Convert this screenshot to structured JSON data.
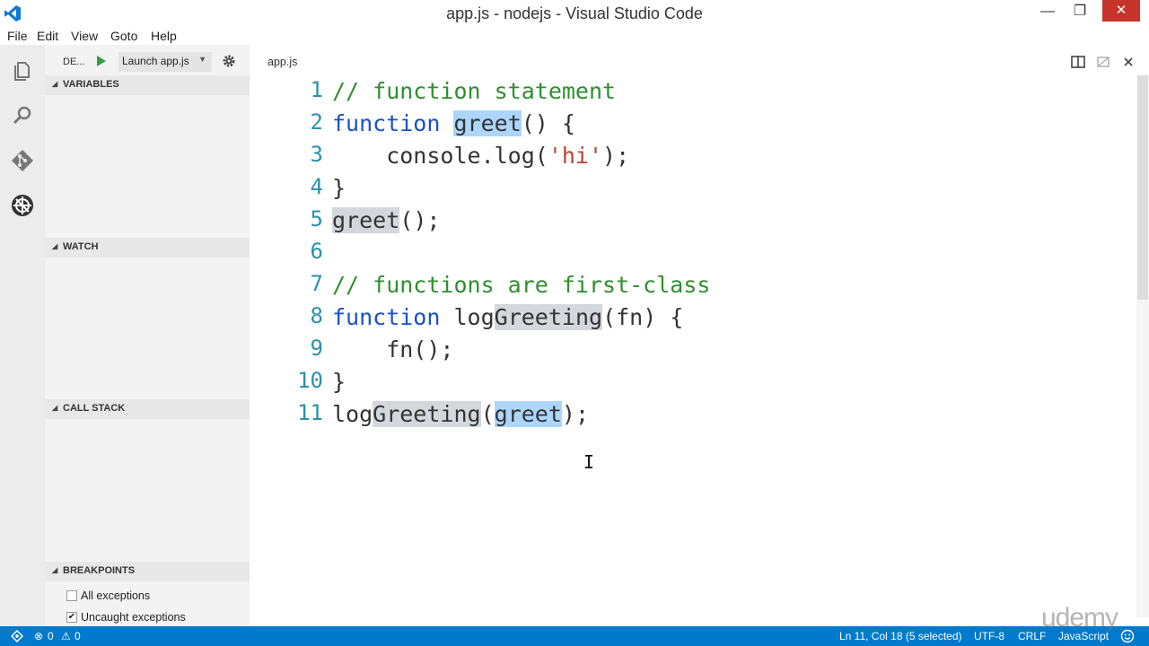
{
  "window": {
    "title": "app.js - nodejs - Visual Studio Code",
    "minimize": "—",
    "maximize": "❐",
    "close": "✕"
  },
  "menu": [
    "File",
    "Edit",
    "View",
    "Goto",
    "Help"
  ],
  "activity_icons": [
    "explorer-icon",
    "search-icon",
    "git-icon",
    "debug-icon"
  ],
  "debug": {
    "title": "DE...",
    "config": "Launch app.js",
    "config_arrow": "▼"
  },
  "sections": {
    "variables": "VARIABLES",
    "watch": "WATCH",
    "call_stack": "CALL STACK",
    "breakpoints": "BREAKPOINTS",
    "collapse_glyph": "◢"
  },
  "breakpoints": [
    {
      "label": "All exceptions",
      "checked": false
    },
    {
      "label": "Uncaught exceptions",
      "checked": true
    }
  ],
  "editor": {
    "tab": "app.js",
    "lines": [
      {
        "n": "1",
        "segs": [
          {
            "t": "// function statement",
            "c": "cm"
          }
        ]
      },
      {
        "n": "2",
        "segs": [
          {
            "t": "function",
            "c": "kw"
          },
          {
            "t": " "
          },
          {
            "t": "greet",
            "c": "sel"
          },
          {
            "t": "() {"
          }
        ]
      },
      {
        "n": "3",
        "segs": [
          {
            "t": "    console.log("
          },
          {
            "t": "'hi'",
            "c": "st"
          },
          {
            "t": ");"
          }
        ]
      },
      {
        "n": "4",
        "segs": [
          {
            "t": "}"
          }
        ]
      },
      {
        "n": "5",
        "segs": [
          {
            "t": "greet",
            "c": "hl"
          },
          {
            "t": "();"
          }
        ]
      },
      {
        "n": "6",
        "segs": []
      },
      {
        "n": "7",
        "segs": [
          {
            "t": "// functions are first-class",
            "c": "cm"
          }
        ]
      },
      {
        "n": "8",
        "segs": [
          {
            "t": "function",
            "c": "kw"
          },
          {
            "t": " log"
          },
          {
            "t": "Greeting",
            "c": "hl"
          },
          {
            "t": "(fn) {"
          }
        ]
      },
      {
        "n": "9",
        "segs": [
          {
            "t": "    fn();"
          }
        ]
      },
      {
        "n": "10",
        "segs": [
          {
            "t": "}"
          }
        ]
      },
      {
        "n": "11",
        "segs": [
          {
            "t": "log"
          },
          {
            "t": "Greeting",
            "c": "hl"
          },
          {
            "t": "("
          },
          {
            "t": "greet",
            "c": "sel"
          },
          {
            "t": ");"
          }
        ]
      }
    ],
    "cursor": "I"
  },
  "status": {
    "errors": "0",
    "warnings": "0",
    "position": "Ln 11, Col 18 (5 selected)",
    "encoding": "UTF-8",
    "eol": "CRLF",
    "language": "JavaScript",
    "error_glyph": "⊗",
    "warning_glyph": "⚠"
  },
  "watermark": "udemy",
  "colors": {
    "status_bar": "#007acc",
    "keyword": "#1a51c7",
    "comment": "#2f8f2f",
    "string": "#b6442f",
    "line_number": "#2b91af"
  }
}
